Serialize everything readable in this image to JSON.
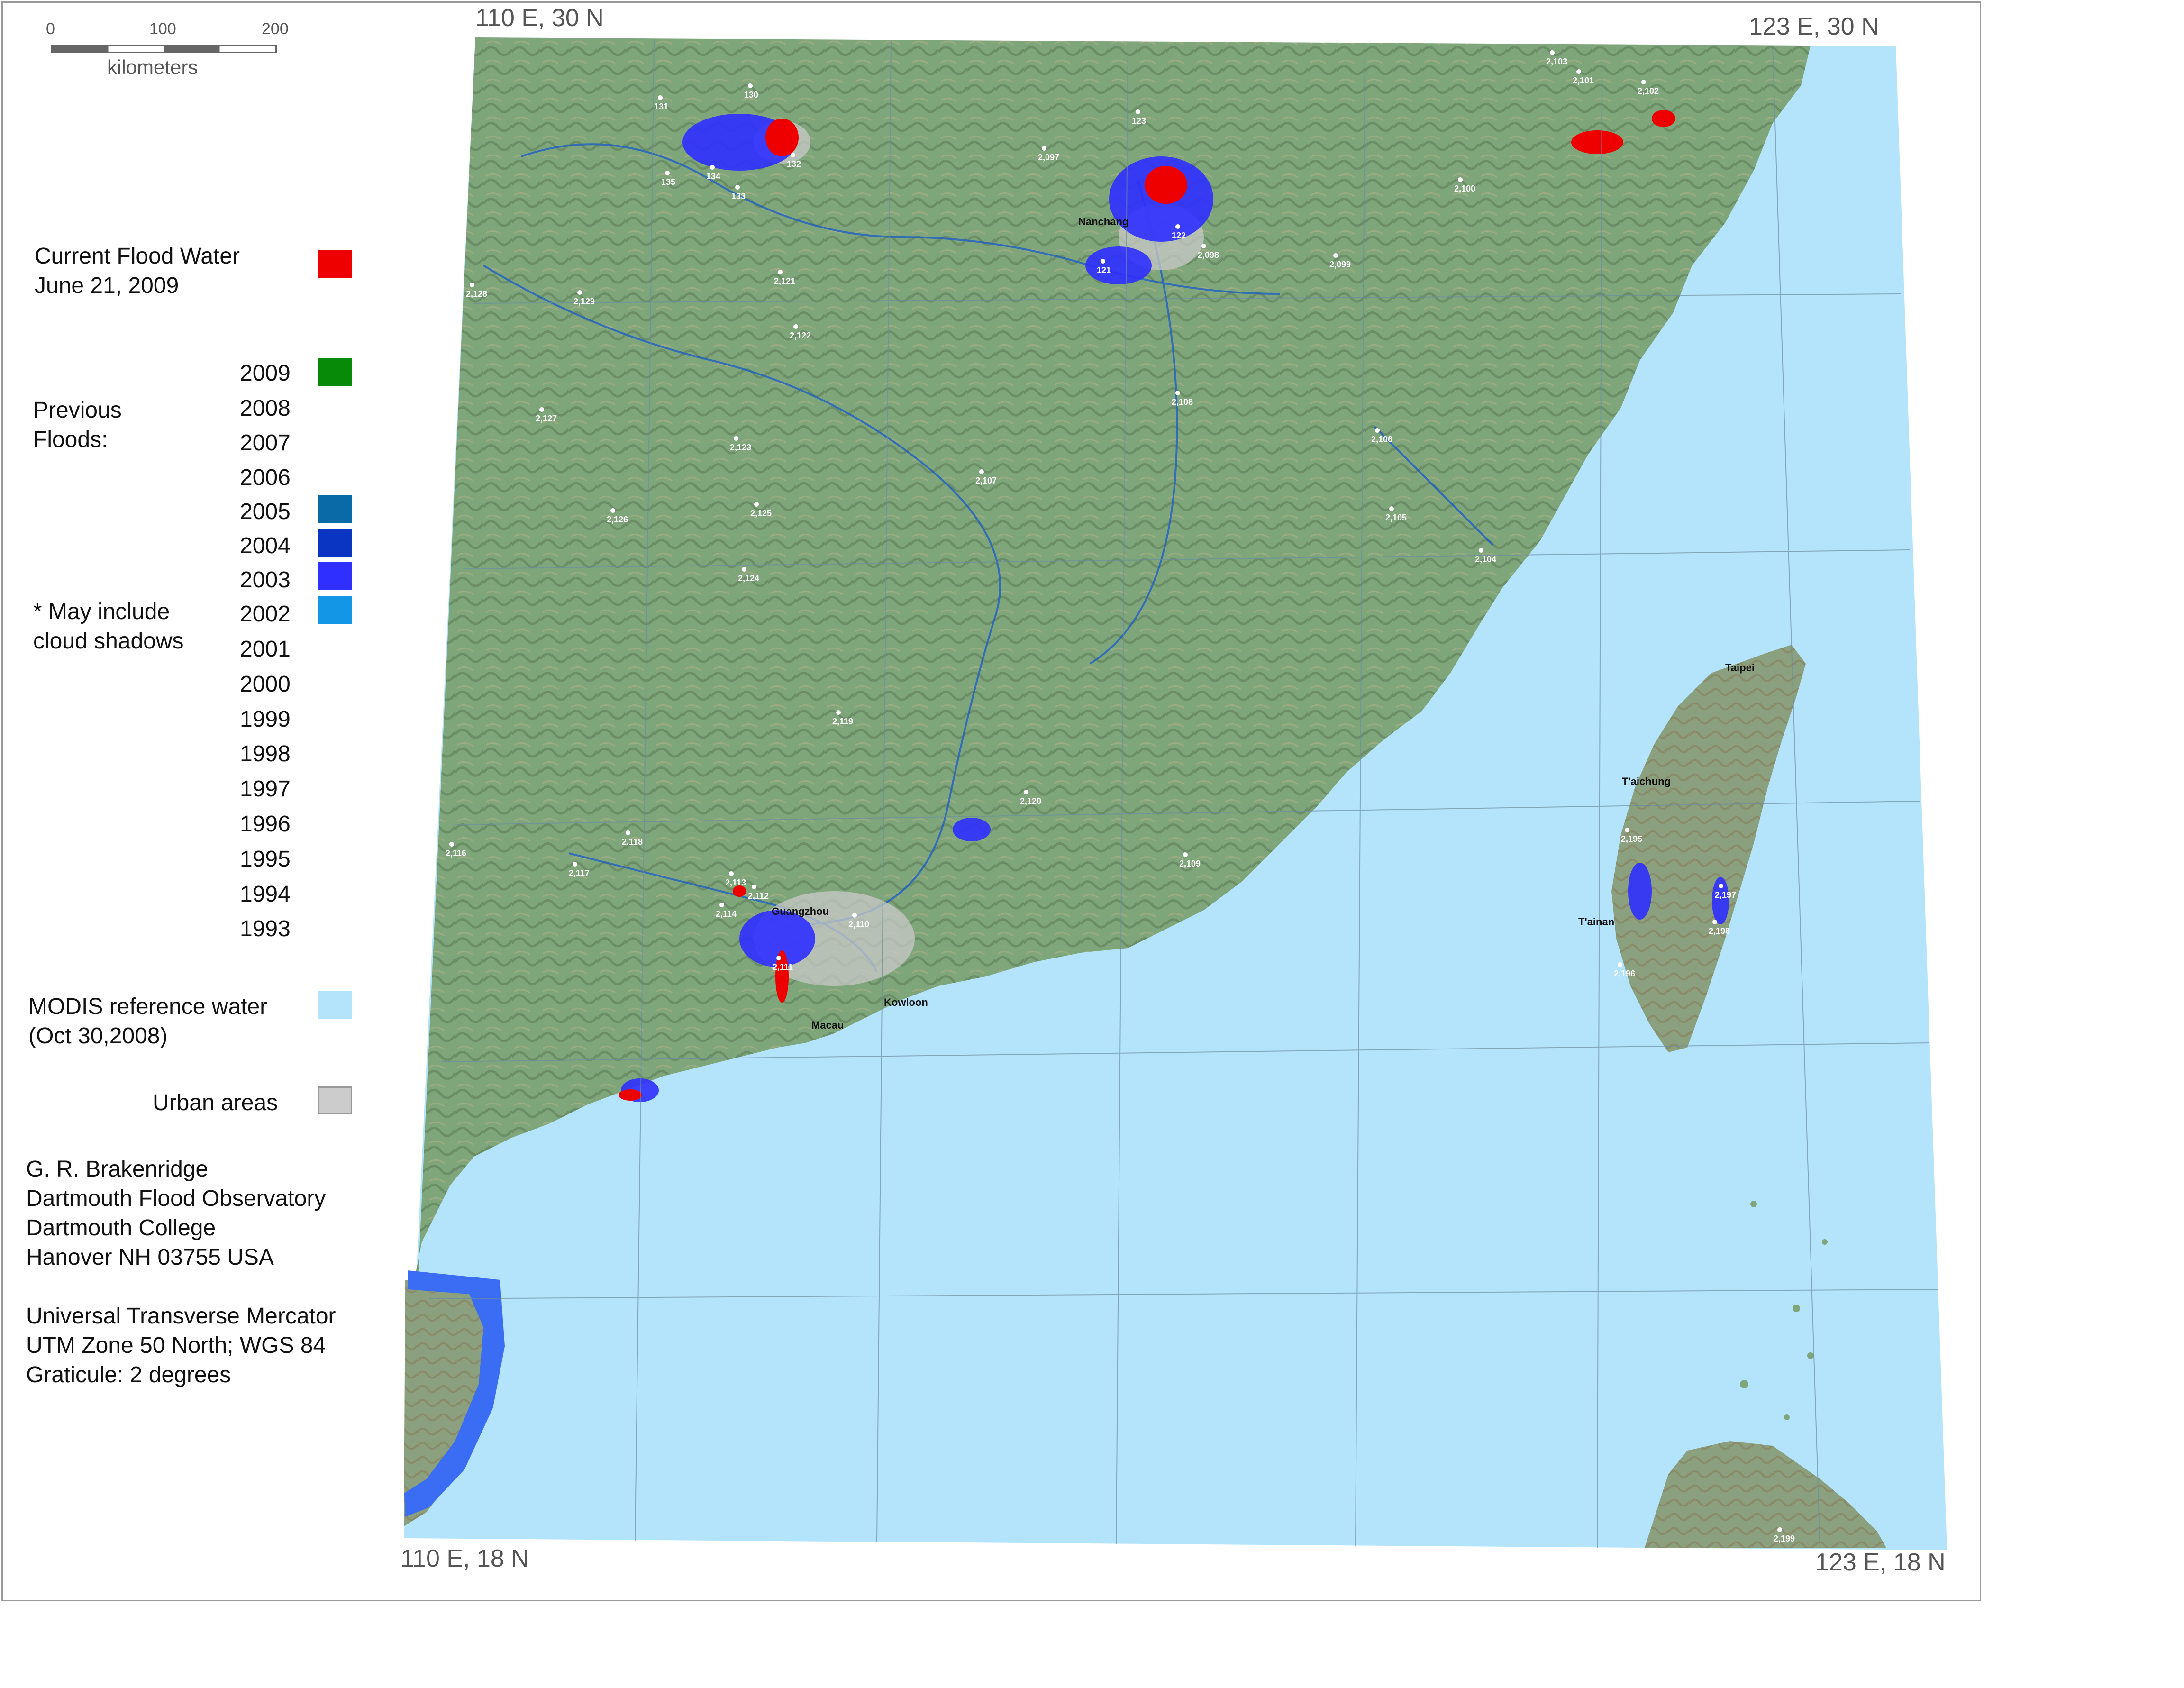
{
  "corners": {
    "nw": "110 E, 30 N",
    "ne": "123 E, 30 N",
    "sw": "110 E, 18 N",
    "se": "123 E, 18 N"
  },
  "scalebar": {
    "ticks": [
      "0",
      "100",
      "200"
    ],
    "unit": "kilometers"
  },
  "legend": {
    "current_flood": {
      "line1": "Current Flood Water",
      "line2": "June 21, 2009",
      "color": "#ee0000"
    },
    "previous_label": {
      "line1": "Previous",
      "line2": "Floods:"
    },
    "cloud_note": {
      "line1": "* May include",
      "line2": "cloud shadows"
    },
    "years": [
      "2009",
      "2008",
      "2007",
      "2006",
      "2005",
      "2004",
      "2003",
      "2002",
      "2001",
      "2000",
      "1999",
      "1998",
      "1997",
      "1996",
      "1995",
      "1994",
      "1993"
    ],
    "year_colors": {
      "2009": "#078a07",
      "2005": "#0a6aa8",
      "2004": "#0a35c2",
      "2003": "#2f2fff",
      "2002": "#1496e6"
    },
    "modis": {
      "line1": "MODIS reference water",
      "line2": "(Oct 30,2008)",
      "color": "#b4e4fc"
    },
    "urban": {
      "label": "Urban areas",
      "color": "#cccccc"
    }
  },
  "credits": [
    "G. R. Brakenridge",
    "Dartmouth Flood Observatory",
    "Dartmouth College",
    "Hanover NH 03755 USA"
  ],
  "projection": [
    "Universal Transverse Mercator",
    "UTM Zone 50 North; WGS 84",
    "Graticule:  2 degrees"
  ],
  "cities": [
    "Nanchang",
    "Guangzhou",
    "Kowloon",
    "Macau",
    "Taipei",
    "T'aichung",
    "T'ainan"
  ],
  "gauges": [
    "131",
    "130",
    "132",
    "135",
    "134",
    "133",
    "2,097",
    "123",
    "121",
    "122",
    "2,098",
    "2,099",
    "2,100",
    "2,103",
    "2,101",
    "2,102",
    "2,128",
    "2,129",
    "2,121",
    "2,122",
    "2,127",
    "2,123",
    "2,108",
    "2,106",
    "2,107",
    "2,126",
    "2,125",
    "2,105",
    "2,104",
    "2,124",
    "2,119",
    "2,120",
    "2,116",
    "2,118",
    "2,117",
    "2,109",
    "2,113",
    "2,112",
    "2,114",
    "2,110",
    "2,111",
    "2,195",
    "2,197",
    "2,196",
    "2,198",
    "2,199"
  ]
}
